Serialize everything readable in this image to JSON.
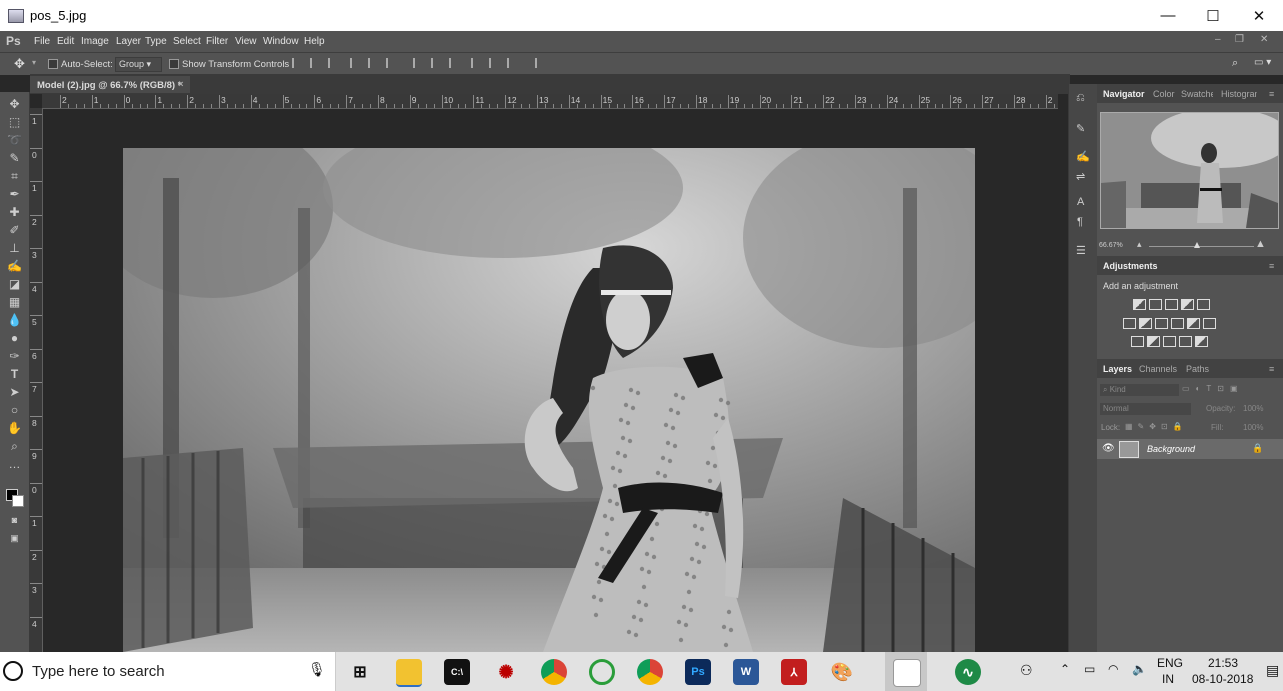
{
  "window": {
    "title": "pos_5.jpg",
    "minimize": "—",
    "maximize": "☐",
    "close": "✕"
  },
  "menubar": {
    "logo": "Ps",
    "items": [
      "File",
      "Edit",
      "Image",
      "Layer",
      "Type",
      "Select",
      "Filter",
      "View",
      "Window",
      "Help"
    ]
  },
  "options": {
    "auto_select_label": "Auto-Select:",
    "auto_select_value": "Group",
    "transform_label": "Show Transform Controls"
  },
  "document": {
    "tab_title": "Model (2).jpg @ 66.7% (RGB/8) *",
    "close": "×"
  },
  "ruler": {
    "h_numbers": [
      "2",
      "1",
      "0",
      "1",
      "2",
      "3",
      "4",
      "5",
      "6",
      "7",
      "8",
      "9",
      "10",
      "11",
      "12",
      "13",
      "14",
      "15",
      "16",
      "17",
      "18",
      "19",
      "20",
      "21",
      "22",
      "23",
      "24",
      "25",
      "26",
      "27",
      "28",
      "2"
    ],
    "v_numbers": [
      "1",
      "0",
      "1",
      "2",
      "3",
      "4",
      "5",
      "6",
      "7",
      "8",
      "9",
      "0",
      "1",
      "2",
      "3",
      "4"
    ]
  },
  "navigator": {
    "tabs": [
      "Navigator",
      "Color",
      "Swatches",
      "Histogram"
    ],
    "zoom": "66.67%"
  },
  "adjustments": {
    "title": "Adjustments",
    "subtitle": "Add an adjustment"
  },
  "layers": {
    "tabs": [
      "Layers",
      "Channels",
      "Paths"
    ],
    "kind": "Kind",
    "blend": "Normal",
    "opacity_label": "Opacity:",
    "opacity": "100%",
    "lock_label": "Lock:",
    "fill_label": "Fill:",
    "fill": "100%",
    "layer_name": "Background"
  },
  "taskbar": {
    "search_placeholder": "Type here to search",
    "lang": "ENG",
    "region": "IN",
    "time": "21:53",
    "date": "08-10-2018",
    "apps": [
      "task-view",
      "file-explorer",
      "terminal",
      "spider-app",
      "chrome",
      "green-app",
      "chrome-2",
      "photoshop",
      "word",
      "acrobat",
      "paint",
      "notes",
      "activity-monitor"
    ]
  },
  "colors": {
    "ps_bg": "#535353",
    "ps_dark": "#282828",
    "taskbar": "#e2e2e2",
    "ps_blue": "#0c2a5a",
    "word_blue": "#2b5797",
    "acrobat_red": "#c21e1e"
  }
}
